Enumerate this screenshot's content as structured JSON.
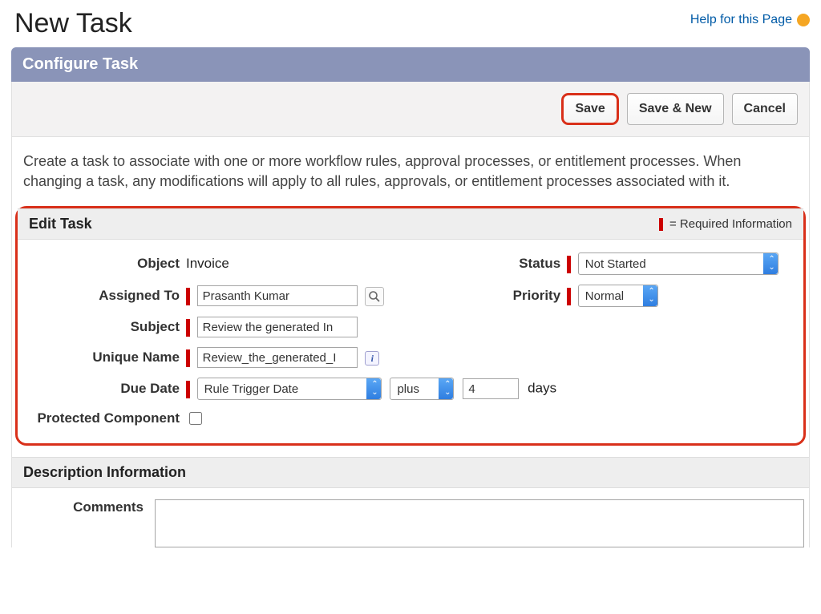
{
  "pageTitle": "New Task",
  "helpLink": "Help for this Page",
  "configureBar": "Configure Task",
  "buttons": {
    "save": "Save",
    "saveNew": "Save & New",
    "cancel": "Cancel"
  },
  "description": "Create a task to associate with one or more workflow rules, approval processes, or entitlement processes. When changing a task, any modifications will apply to all rules, approvals, or entitlement processes associated with it.",
  "editTask": {
    "title": "Edit Task",
    "requiredLegend": "= Required Information",
    "labels": {
      "object": "Object",
      "assignedTo": "Assigned To",
      "subject": "Subject",
      "uniqueName": "Unique Name",
      "dueDate": "Due Date",
      "protected": "Protected Component",
      "status": "Status",
      "priority": "Priority",
      "daysSuffix": "days"
    },
    "values": {
      "object": "Invoice",
      "assignedTo": "Prasanth Kumar",
      "subject": "Review the generated In",
      "uniqueName": "Review_the_generated_I",
      "dueDateBase": "Rule Trigger Date",
      "dueDateOp": "plus",
      "dueDateDays": "4",
      "status": "Not Started",
      "priority": "Normal",
      "protected": false
    }
  },
  "descInfo": {
    "title": "Description Information",
    "commentsLabel": "Comments",
    "commentsValue": ""
  }
}
